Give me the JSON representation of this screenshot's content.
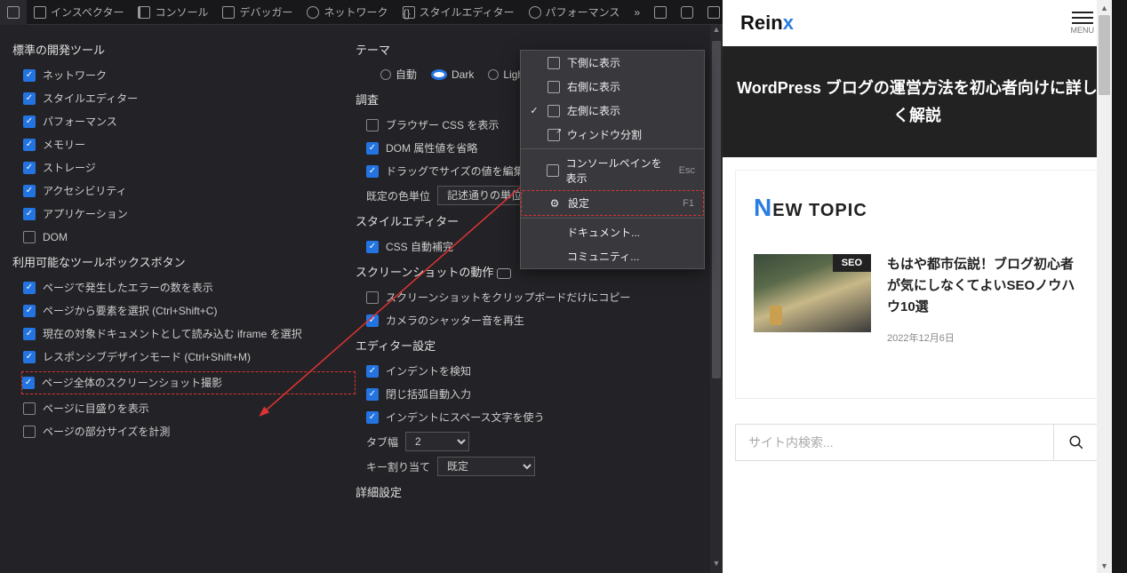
{
  "toolbar": {
    "inspector": "インスペクター",
    "console": "コンソール",
    "debugger": "デバッガー",
    "network": "ネットワーク",
    "styleeditor": "スタイルエディター",
    "performance": "パフォーマンス",
    "more": "»",
    "meatball": "•••",
    "close": "✕"
  },
  "sections": {
    "default_tools": "標準の開発ツール",
    "toolbox_buttons": "利用可能なツールボックスボタン",
    "theme": "テーマ",
    "inspectorSec": "調査",
    "styleEditorSec": "スタイルエディター",
    "screenshotSec": "スクリーンショットの動作",
    "editorSec": "エディター設定",
    "advanced": "詳細設定"
  },
  "tools": {
    "network": "ネットワーク",
    "styleeditor": "スタイルエディター",
    "performance": "パフォーマンス",
    "memory": "メモリー",
    "storage": "ストレージ",
    "accessibility": "アクセシビリティ",
    "application": "アプリケーション",
    "dom": "DOM"
  },
  "buttons": {
    "errorCount": "ページで発生したエラーの数を表示",
    "pickElement": "ページから要素を選択 (Ctrl+Shift+C)",
    "iframeTarget": "現在の対象ドキュメントとして読み込む iframe を選択",
    "responsive": "レスポンシブデザインモード (Ctrl+Shift+M)",
    "fullPageShot": "ページ全体のスクリーンショット撮影",
    "rulers": "ページに目盛りを表示",
    "measure": "ページの部分サイズを計測"
  },
  "themeOpts": {
    "auto": "自動",
    "dark": "Dark",
    "light": "Light"
  },
  "insp": {
    "browserCss": "ブラウザー CSS を表示",
    "truncateDom": "DOM 属性値を省略",
    "dragResize": "ドラッグでサイズの値を編集",
    "colorUnitLabel": "既定の色単位",
    "colorUnitValue": "記述通りの単位"
  },
  "styleEd": {
    "autocss": "CSS 自動補完"
  },
  "shot": {
    "clipboard": "スクリーンショットをクリップボードだけにコピー",
    "shutter": "カメラのシャッター音を再生"
  },
  "editor": {
    "detectIndent": "インデントを検知",
    "autoClose": "閉じ括弧自動入力",
    "indentSpaces": "インデントにスペース文字を使う",
    "tabWidthLabel": "タブ幅",
    "tabWidthValue": "2",
    "keymapLabel": "キー割り当て",
    "keymapValue": "既定"
  },
  "dropdown": {
    "dockBottom": "下側に表示",
    "dockRight": "右側に表示",
    "dockLeft": "左側に表示",
    "separate": "ウィンドウ分割",
    "splitConsole": "コンソールペインを表示",
    "splitConsoleKey": "Esc",
    "settings": "設定",
    "settingsKey": "F1",
    "docs": "ドキュメント...",
    "community": "コミュニティ..."
  },
  "site": {
    "logo1": "Rein",
    "logo2": "x",
    "menu": "MENU",
    "heroTitle": "WordPress ブログの運営方法を初心者向けに詳しく解説",
    "topicHeading": "EW TOPIC",
    "topicN": "N",
    "badge": "SEO",
    "articleTitle": "もはや都市伝説！ブログ初心者が気にしなくてよいSEOノウハウ10選",
    "articleDate": "2022年12月6日",
    "searchPlaceholder": "サイト内検索..."
  }
}
